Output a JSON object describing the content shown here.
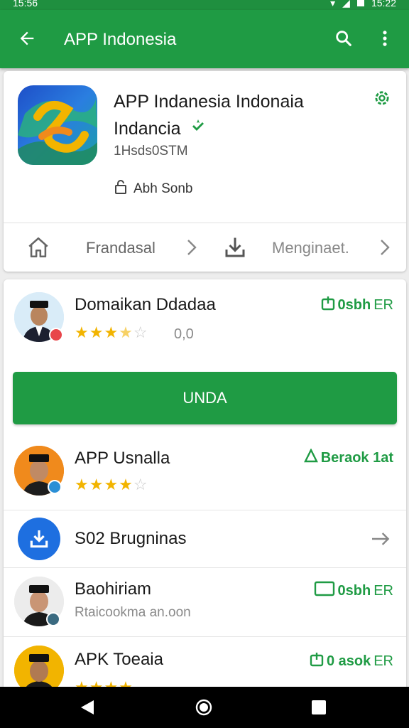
{
  "status": {
    "time_left": "15:56",
    "time_right": "15:22"
  },
  "appbar": {
    "title": "APP Indonesia"
  },
  "app": {
    "title": "APP Indanesia Indonaia Indancia",
    "size": "1Hsds0STM",
    "meta": "Abh Sonb"
  },
  "nav_row": {
    "label1": "Frandasal",
    "label2": "Menginaet."
  },
  "list": {
    "item1": {
      "name": "Domaikan Ddadaa",
      "rating_text": "0,0",
      "rating": 3.5,
      "action": "0sbh",
      "action_suffix": "ER"
    },
    "button": "UNDA",
    "item2": {
      "name": "APP Usnalla",
      "rating": 4,
      "action": "Beraok 1at"
    },
    "item3": {
      "name": "S02 Brugninas"
    },
    "item4": {
      "name": "Baohiriam",
      "sub": "Rtaicookma an.oon",
      "action": "0sbh",
      "action_suffix": "ER"
    },
    "item5": {
      "name": "APK Toeaia",
      "action": "0 asok",
      "action_suffix": "ER"
    }
  },
  "colors": {
    "primary": "#1f9b44",
    "star": "#f2b400",
    "download_blue": "#1e6fe0"
  }
}
